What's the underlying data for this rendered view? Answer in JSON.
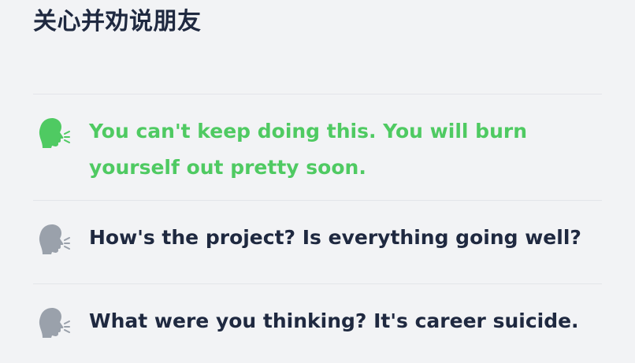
{
  "page": {
    "title": "关心并劝说朋友"
  },
  "options": [
    {
      "icon": "speaking-head-icon",
      "text": "You can't keep doing this. You will burn yourself out pretty soon.",
      "selected": true,
      "color": "#4fca62"
    },
    {
      "icon": "speaking-head-icon",
      "text": "How's the project? Is everything going well?",
      "selected": false,
      "color": "#9aa1ab"
    },
    {
      "icon": "speaking-head-icon",
      "text": "What were you thinking? It's career suicide.",
      "selected": false,
      "color": "#9aa1ab"
    }
  ]
}
